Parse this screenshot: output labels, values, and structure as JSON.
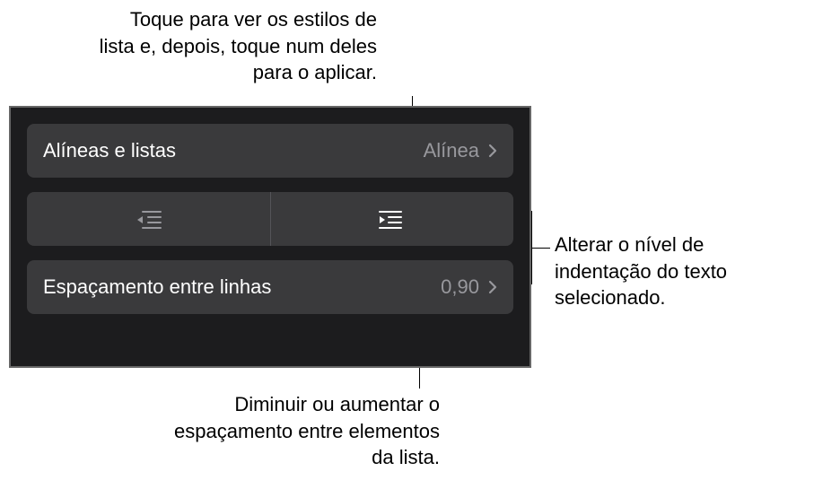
{
  "callouts": {
    "top": "Toque para ver os estilos de lista e, depois, toque num deles para o aplicar.",
    "right": "Alterar o nível de indentação do texto selecionado.",
    "bottom": "Diminuir ou aumentar o espaçamento entre elementos da lista."
  },
  "panel": {
    "bulletsLists": {
      "label": "Alíneas e listas",
      "value": "Alínea"
    },
    "lineSpacing": {
      "label": "Espaçamento entre linhas",
      "value": "0,90"
    }
  }
}
